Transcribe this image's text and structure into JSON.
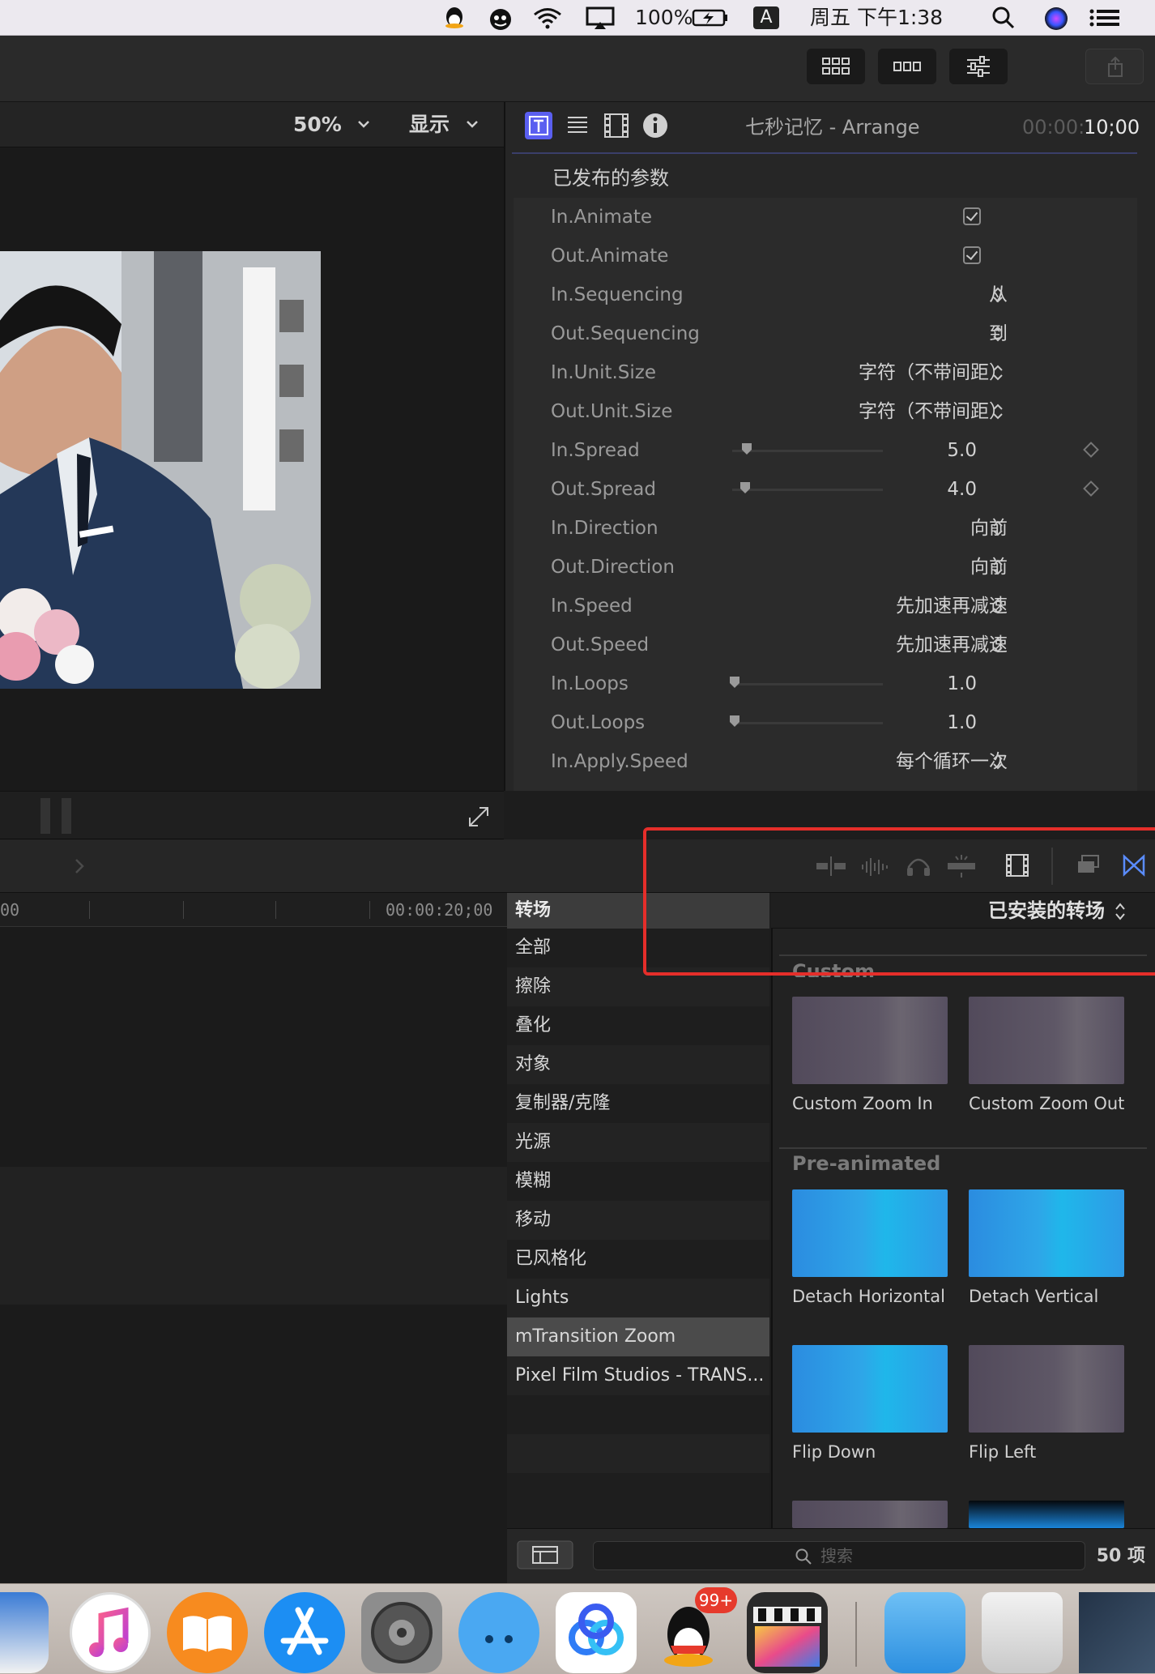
{
  "menubar": {
    "battery": "100%",
    "input_method": "A",
    "clock": "周五 下午1:38"
  },
  "viewer": {
    "zoom": "50%",
    "display_menu": "显示"
  },
  "inspector": {
    "title": "七秒记忆 - Arrange",
    "timecode_dim": "00:00:",
    "timecode": "10;00",
    "section": "已发布的参数",
    "params": [
      {
        "label": "In.Animate",
        "type": "checkbox",
        "checked": true
      },
      {
        "label": "Out.Animate",
        "type": "checkbox",
        "checked": true
      },
      {
        "label": "In.Sequencing",
        "type": "popup",
        "value": "从"
      },
      {
        "label": "Out.Sequencing",
        "type": "popup",
        "value": "到"
      },
      {
        "label": "In.Unit.Size",
        "type": "popup",
        "value": "字符（不带间距）"
      },
      {
        "label": "Out.Unit.Size",
        "type": "popup",
        "value": "字符（不带间距）"
      },
      {
        "label": "In.Spread",
        "type": "slider",
        "value": "5.0",
        "level": 0.05
      },
      {
        "label": "Out.Spread",
        "type": "slider",
        "value": "4.0",
        "level": 0.04
      },
      {
        "label": "In.Direction",
        "type": "popup",
        "value": "向前"
      },
      {
        "label": "Out.Direction",
        "type": "popup",
        "value": "向前"
      },
      {
        "label": "In.Speed",
        "type": "popup",
        "value": "先加速再减速"
      },
      {
        "label": "Out.Speed",
        "type": "popup",
        "value": "先加速再减速"
      },
      {
        "label": "In.Loops",
        "type": "slider",
        "value": "1.0",
        "level": 0.0
      },
      {
        "label": "Out.Loops",
        "type": "slider",
        "value": "1.0",
        "level": 0.0
      },
      {
        "label": "In.Apply.Speed",
        "type": "popup",
        "value": "每个循环一次"
      }
    ]
  },
  "timeline": {
    "ruler_left": "00",
    "ruler_right": "00:00:20;00"
  },
  "browser": {
    "category_header": "转场",
    "categories": [
      "全部",
      "擦除",
      "叠化",
      "对象",
      "复制器/克隆",
      "光源",
      "模糊",
      "移动",
      "已风格化",
      "Lights",
      "mTransition Zoom",
      "Pixel Film Studios - TRANS..."
    ],
    "selected_category": "mTransition Zoom",
    "filter": "已安装的转场",
    "sections": [
      {
        "title": "Custom",
        "items": [
          "Custom Zoom In",
          "Custom Zoom Out"
        ]
      },
      {
        "title": "Pre-animated",
        "items": [
          "Detach Horizontal",
          "Detach Vertical",
          "Flip Down",
          "Flip Left"
        ]
      }
    ],
    "search_placeholder": "搜索",
    "count": "50 项"
  },
  "dock": {
    "badge": "99+"
  },
  "colors": {
    "accent": "#5a5ff0",
    "annotation": "#e52e2a",
    "thumb_blue": "#2ea6e8",
    "thumb_purple": "#5e5766"
  }
}
